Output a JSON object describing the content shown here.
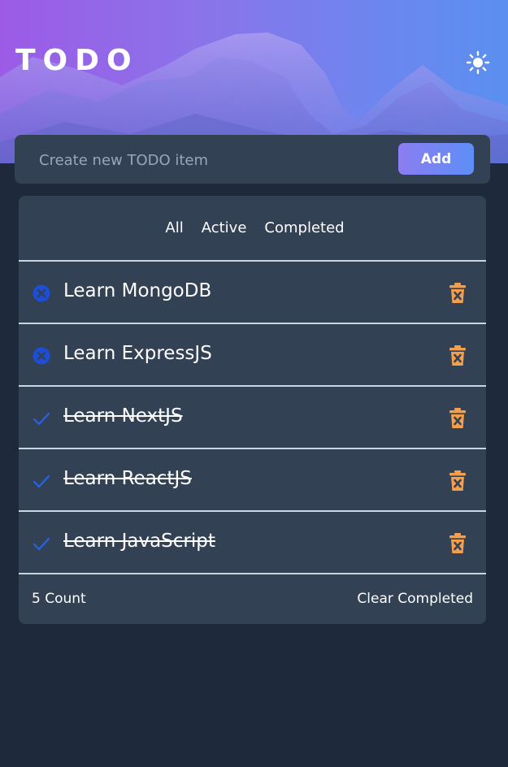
{
  "app": {
    "title": "TODO",
    "theme_icon": "sun-icon"
  },
  "new_item": {
    "placeholder": "Create new TODO item",
    "value": "",
    "add_label": "Add"
  },
  "filters": [
    {
      "label": "All"
    },
    {
      "label": "Active"
    },
    {
      "label": "Completed"
    }
  ],
  "todos": [
    {
      "text": "Learn MongoDB",
      "completed": false,
      "status_icon": "x-circle-icon"
    },
    {
      "text": "Learn ExpressJS",
      "completed": false,
      "status_icon": "x-circle-icon"
    },
    {
      "text": "Learn NextJS",
      "completed": true,
      "status_icon": "check-icon"
    },
    {
      "text": "Learn ReactJS",
      "completed": true,
      "status_icon": "check-icon"
    },
    {
      "text": "Learn JavaScript",
      "completed": true,
      "status_icon": "check-icon"
    }
  ],
  "footer": {
    "count_label": "5 Count",
    "clear_label": "Clear Completed"
  },
  "colors": {
    "background": "#1e293b",
    "panel": "#334155",
    "accent_blue": "#2563eb",
    "delete_orange": "#f59e4b",
    "divider": "#cbd5e1"
  }
}
